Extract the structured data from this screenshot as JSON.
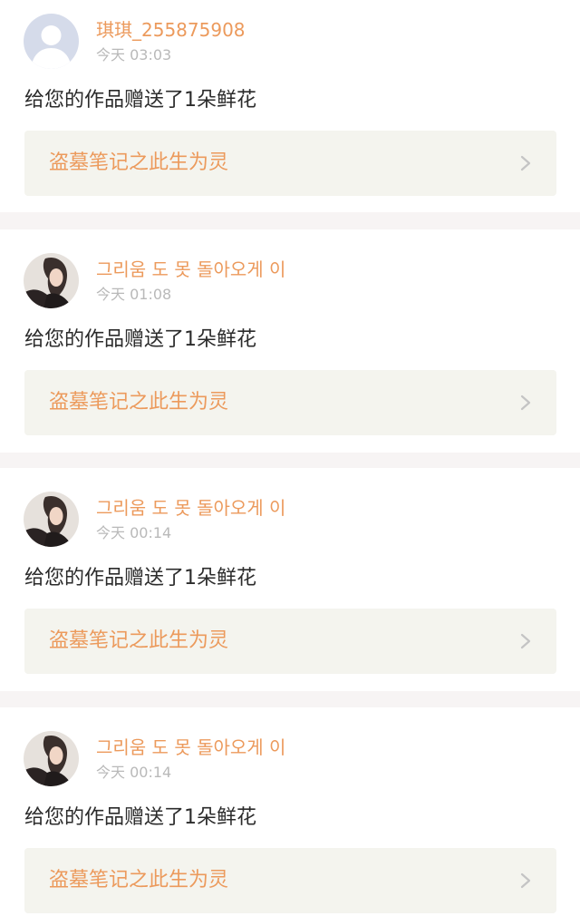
{
  "colors": {
    "accent": "#ec9a5c",
    "text": "#2b2b2b",
    "muted": "#b9b9b9",
    "link_bg": "#f4f4ee",
    "separator": "#f7f4f4"
  },
  "notifications": [
    {
      "avatar_icon": "default-user-avatar-icon",
      "username": "琪琪_255875908",
      "time": "今天 03:03",
      "message": "给您的作品赠送了1朵鲜花",
      "work_title": "盗墓笔记之此生为灵",
      "chevron_icon": "chevron-right-icon"
    },
    {
      "avatar_icon": "photo-avatar-icon",
      "username": "그리움 도 못 돌아오게 이",
      "time": "今天 01:08",
      "message": "给您的作品赠送了1朵鲜花",
      "work_title": "盗墓笔记之此生为灵",
      "chevron_icon": "chevron-right-icon"
    },
    {
      "avatar_icon": "photo-avatar-icon",
      "username": "그리움 도 못 돌아오게 이",
      "time": "今天 00:14",
      "message": "给您的作品赠送了1朵鲜花",
      "work_title": "盗墓笔记之此生为灵",
      "chevron_icon": "chevron-right-icon"
    },
    {
      "avatar_icon": "photo-avatar-icon",
      "username": "그리움 도 못 돌아오게 이",
      "time": "今天 00:14",
      "message": "给您的作品赠送了1朵鲜花",
      "work_title": "盗墓笔记之此生为灵",
      "chevron_icon": "chevron-right-icon"
    }
  ]
}
